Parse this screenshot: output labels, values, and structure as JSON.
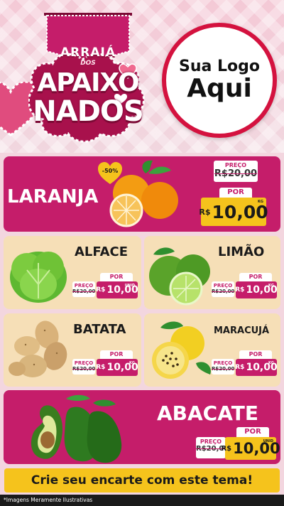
{
  "header": {
    "banner_line1": "ARRAIÁ",
    "banner_line2": "DOS",
    "banner_line3": "APAIXO",
    "banner_line4": "NADOS",
    "logo_line1": "Sua Logo",
    "logo_line2": "Aqui"
  },
  "featured": {
    "name": "LARANJA",
    "discount": "-50%",
    "old_label": "PREÇO",
    "old_price": "R$20,00",
    "por_label": "POR",
    "currency": "R$",
    "new_price": "10,00",
    "unit": "KG"
  },
  "products": [
    {
      "name": "ALFACE",
      "old_label": "PREÇO",
      "old_price": "R$20,00",
      "por_label": "POR",
      "currency": "R$",
      "new_price": "10,00",
      "unit": "UNID"
    },
    {
      "name": "LIMÃO",
      "old_label": "PREÇO",
      "old_price": "R$20,00",
      "por_label": "POR",
      "currency": "R$",
      "new_price": "10,00",
      "unit": "KG"
    },
    {
      "name": "BATATA",
      "old_label": "PREÇO",
      "old_price": "R$20,00",
      "por_label": "POR",
      "currency": "R$",
      "new_price": "10,00",
      "unit": "KG"
    },
    {
      "name": "MARACUJÁ",
      "old_label": "PREÇO",
      "old_price": "R$20,00",
      "por_label": "POR",
      "currency": "R$",
      "new_price": "10,00",
      "unit": "KG"
    }
  ],
  "bottom_featured": {
    "name": "ABACATE",
    "old_label": "PREÇO",
    "old_price": "R$20,00",
    "por_label": "POR",
    "currency": "R$",
    "new_price": "10,00",
    "unit": "UNID"
  },
  "cta": "Crie seu encarte com este tema!",
  "footnote": "*Imagens Meramente Ilustrativas",
  "colors": {
    "magenta": "#c51d6a",
    "cream": "#f6dfb7",
    "yellow": "#f5c31c",
    "red_border": "#d4123f"
  }
}
